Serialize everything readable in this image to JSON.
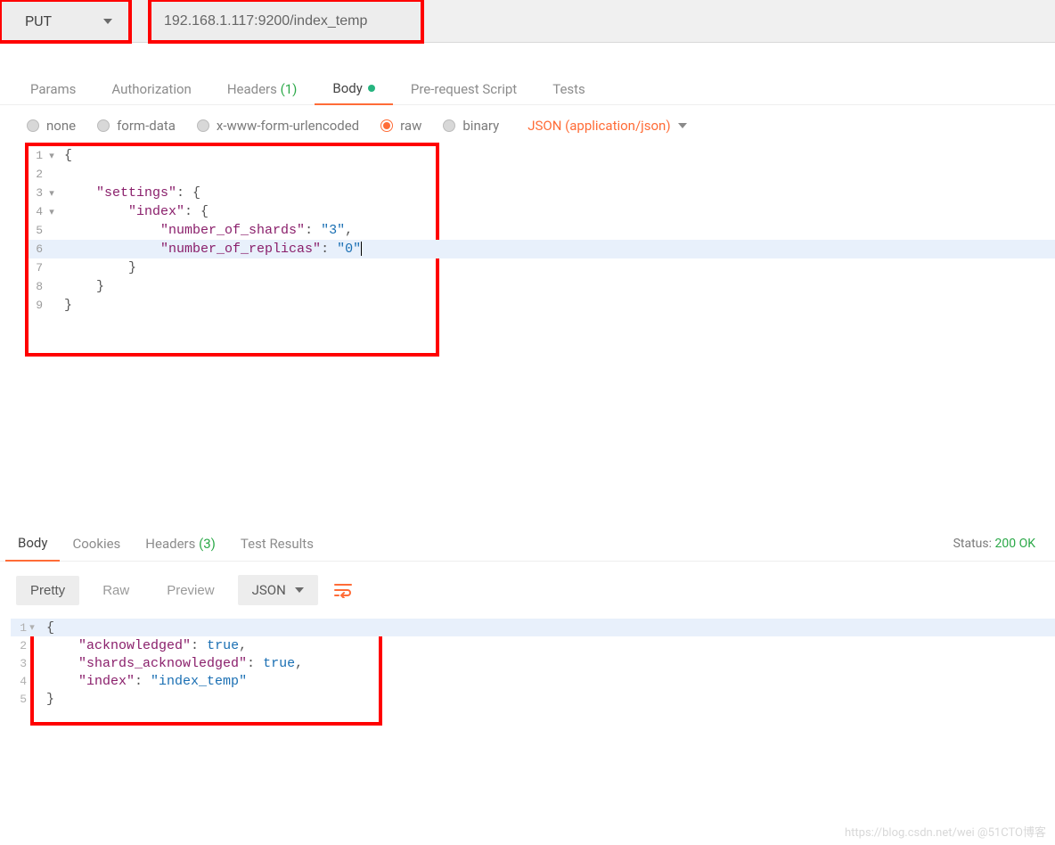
{
  "request": {
    "method": "PUT",
    "url": "192.168.1.117:9200/index_temp"
  },
  "tabs": {
    "params": "Params",
    "authorization": "Authorization",
    "headers_label": "Headers",
    "headers_count": "(1)",
    "body": "Body",
    "prerequest": "Pre-request Script",
    "tests": "Tests"
  },
  "body_options": {
    "none": "none",
    "form_data": "form-data",
    "xwww": "x-www-form-urlencoded",
    "raw": "raw",
    "binary": "binary",
    "content_type": "JSON (application/json)"
  },
  "request_body": {
    "l1": "{",
    "l3_key": "\"settings\"",
    "l3_rest": ": {",
    "l4_key": "\"index\"",
    "l4_rest": ": {",
    "l5_key": "\"number_of_shards\"",
    "l5_val": "\"3\"",
    "l6_key": "\"number_of_replicas\"",
    "l6_val": "\"0\"",
    "l7": "}",
    "l8": "}",
    "l9": "}"
  },
  "resp_tabs": {
    "body": "Body",
    "cookies": "Cookies",
    "headers_label": "Headers",
    "headers_count": "(3)",
    "test_results": "Test Results"
  },
  "status": {
    "label": "Status:",
    "value": "200 OK"
  },
  "view": {
    "pretty": "Pretty",
    "raw": "Raw",
    "preview": "Preview",
    "json": "JSON"
  },
  "response_body": {
    "l1": "{",
    "l2_key": "\"acknowledged\"",
    "l2_val": "true",
    "l3_key": "\"shards_acknowledged\"",
    "l3_val": "true",
    "l4_key": "\"index\"",
    "l4_val": "\"index_temp\"",
    "l5": "}"
  },
  "watermark": "https://blog.csdn.net/wei @51CTO博客"
}
